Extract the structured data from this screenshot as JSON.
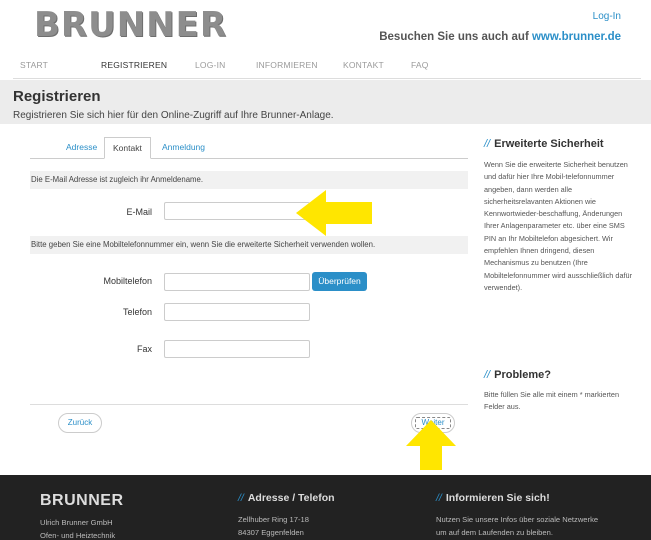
{
  "header": {
    "logo": "BRUNNER",
    "login_link": "Log-In",
    "tagline_prefix": "Besuchen Sie uns auch auf ",
    "tagline_url": "www.brunner.de"
  },
  "nav": {
    "items": [
      {
        "label": "START"
      },
      {
        "label": "REGISTRIEREN"
      },
      {
        "label": "LOG-IN"
      },
      {
        "label": "INFORMIEREN"
      },
      {
        "label": "KONTAKT"
      },
      {
        "label": "FAQ"
      }
    ]
  },
  "page": {
    "title": "Registrieren",
    "subtitle": "Registrieren Sie sich hier für den Online-Zugriff auf Ihre Brunner-Anlage."
  },
  "form": {
    "tabs": [
      {
        "label": "Adresse"
      },
      {
        "label": "Kontakt"
      },
      {
        "label": "Anmeldung"
      }
    ],
    "email_info": "Die E-Mail Adresse ist zugleich ihr Anmeldename.",
    "email_label": "E-Mail",
    "email_value": "",
    "mobile_info": "Bitte geben Sie eine Mobiltelefonnummer ein, wenn Sie die erweiterte Sicherheit verwenden wollen.",
    "mobile_label": "Mobiltelefon",
    "mobile_value": "",
    "check_button": "Überprüfen",
    "phone_label": "Telefon",
    "phone_value": "",
    "fax_label": "Fax",
    "fax_value": "",
    "back_button": "Zurück",
    "next_button": "Weiter"
  },
  "sidebar": {
    "security_heading": "Erweiterte Sicherheit",
    "security_text": "Wenn Sie die erweiterte Sicherheit benutzen und dafür hier Ihre Mobil-telefonnummer angeben, dann werden alle sicherheitsrelavanten Aktionen wie Kennwortwieder-beschaffung, Änderungen Ihrer Anlagenparameter etc. über eine SMS PIN an Ihr Mobiltelefon abgesichert. Wir empfehlen Ihnen dringend, diesen Mechanismus zu benutzen (Ihre Mobiltelefonnummer wird ausschließlich dafür verwendet).",
    "problems_heading": "Probleme?",
    "problems_text": "Bitte füllen Sie alle mit einem * markierten Felder aus.",
    "heading_marker": "//"
  },
  "footer": {
    "brand": "BRUNNER",
    "company": "Ulrich Brunner GmbH",
    "company_sub": "Ofen- und Heiztechnik",
    "address_heading": "Adresse / Telefon",
    "street": "Zellhuber Ring 17-18",
    "city": "84307 Eggenfelden",
    "info_heading": "Informieren Sie sich!",
    "info_line1": "Nutzen Sie unsere Infos über soziale Netzwerke",
    "info_line2": "um auf dem Laufenden zu bleiben.",
    "heading_marker": "//"
  },
  "colors": {
    "accent": "#2b8fc8",
    "arrow": "#ffe600",
    "footer_bg": "#222222",
    "titlebar_bg": "#ececec"
  },
  "icons": {
    "email_arrow": "left-arrow-annotation",
    "next_arrow": "up-arrow-annotation"
  }
}
